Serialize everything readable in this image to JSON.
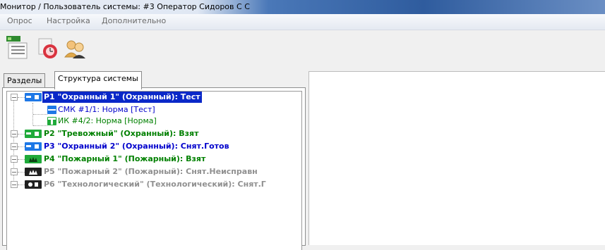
{
  "window": {
    "title": "Монитор / Пользователь системы: #3 Оператор Сидоров С С"
  },
  "menu": {
    "items": [
      "Опрос",
      "Настройка",
      "Дополнительно"
    ]
  },
  "toolbar": {
    "icons": [
      "list-icon",
      "clock-icon",
      "users-icon"
    ]
  },
  "tabs": [
    {
      "label": "Разделы",
      "active": false
    },
    {
      "label": "Структура системы",
      "active": true
    }
  ],
  "tree": {
    "nodes": [
      {
        "label": "Р1 \"Охранный 1\" (Охранный): Тест",
        "color": "#0000cc",
        "selected": true,
        "icon": "security-zone-icon",
        "icon_color": "#1e78e6"
      },
      {
        "label": "СМК #1/1: Норма [Тест]",
        "color": "#0000cc",
        "icon": "smk-sensor-icon",
        "icon_color": "#1e78e6"
      },
      {
        "label": "ИК #4/2: Норма [Норма]",
        "color": "#008000",
        "icon": "ik-sensor-icon",
        "icon_color": "#1faa3a"
      },
      {
        "label": "Р2 \"Тревожный\" (Охранный): Взят",
        "color": "#008000",
        "icon": "security-zone-icon",
        "icon_color": "#1faa3a"
      },
      {
        "label": "Р3 \"Охранный 2\" (Охранный): Снят.Готов",
        "color": "#0000cc",
        "icon": "security-zone-icon",
        "icon_color": "#1e78e6"
      },
      {
        "label": "Р4 \"Пожарный 1\" (Пожарный): Взят",
        "color": "#008000",
        "icon": "fire-zone-icon",
        "icon_color": "#1faa3a"
      },
      {
        "label": "Р5 \"Пожарный 2\" (Пожарный): Снят.Неисправн",
        "color": "#909090",
        "icon": "fire-zone-icon",
        "icon_color": "#202020"
      },
      {
        "label": "Р6 \"Технологический\" (Технологический): Снят.Г",
        "color": "#909090",
        "icon": "tech-zone-icon",
        "icon_color": "#202020"
      }
    ]
  }
}
